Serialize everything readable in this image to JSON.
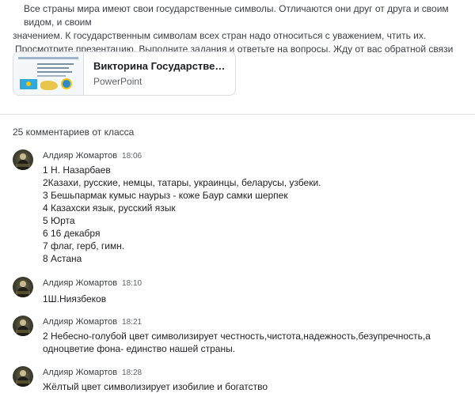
{
  "intro": {
    "line1": "Все страны мира имеют свои государственные символы. Отличаются они друг от друга и своим видом, и своим",
    "line2": "значением. К государственным символам всех стран надо относиться с уважением, чтить их.",
    "line3": "Просмотрите презентацию. Выполните задания и ответьте на вопросы. Жду от вас обратной связи"
  },
  "attachment": {
    "title": "Викторина Государстве…",
    "type": "PowerPoint",
    "thumbnail_icon": "presentation-thumbnail"
  },
  "comments_header": "25 комментариев от класса",
  "comments": [
    {
      "author": "Алдияр Жомартов",
      "time": "18:06",
      "lines": [
        "1 Н. Назарбаев",
        "2Казахи, русские, немцы, татары, украинцы, беларусы, узбеки.",
        "3 Бешьпармак кумыс наурыз - коже Баур самки шерпек",
        "4  Казахски язык, русский язык",
        "5 Юрта",
        "6 16 декабря",
        "7 флаг, герб, гимн.",
        "8 Астана"
      ]
    },
    {
      "author": "Алдияр Жомартов",
      "time": "18:10",
      "lines": [
        "1Ш.Ниязбеков"
      ]
    },
    {
      "author": "Алдияр Жомартов",
      "time": "18:21",
      "lines": [
        "2 Небесно-голубой цвет символизирует честность,чистота,надежность,безупречность,а",
        "одноцветие фона- единство нашей страны."
      ]
    },
    {
      "author": "Алдияр Жомартов",
      "time": "18:28",
      "lines": [
        "Жёлтый цвет символизирует изобилие и богатство"
      ]
    }
  ],
  "colors": {
    "text": "#3c4043",
    "secondary": "#5f6368",
    "border": "#dadce0"
  }
}
